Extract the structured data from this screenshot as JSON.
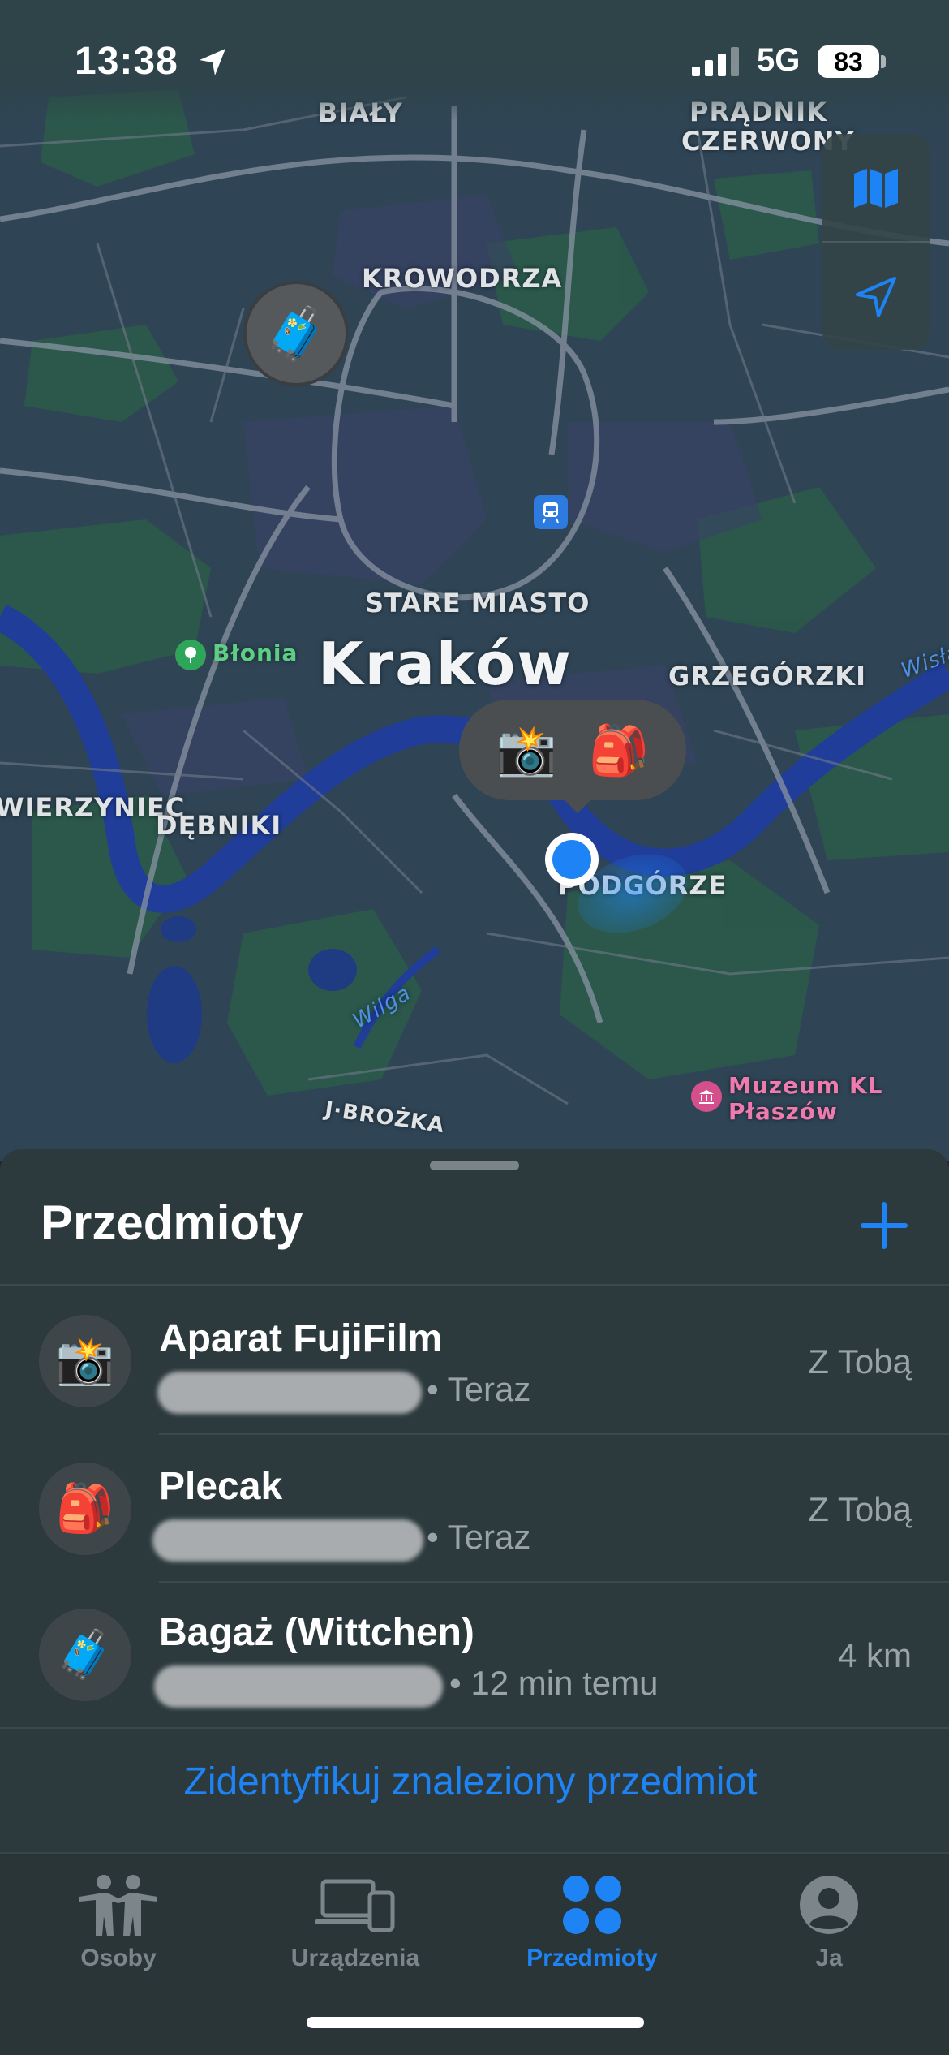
{
  "status_bar": {
    "time": "13:38",
    "network": "5G",
    "battery": "83"
  },
  "map": {
    "city": "Kraków",
    "districts": [
      "BIAŁY",
      "PRĄDNIK CZERWONY",
      "KROWODRZA",
      "STARE MIASTO",
      "GRZEGÓRZKI",
      "ZWIERZYNIEC",
      "DĘBNIKI",
      "PODGÓRZE",
      "J·BROŻKA"
    ],
    "pois": {
      "park": "Błonia",
      "museum_line1": "Muzeum KL",
      "museum_line2": "Płaszów"
    },
    "rivers": {
      "wilga": "Wilga",
      "wisla": "Wisła"
    },
    "controls": {
      "map_mode_icon": "map-icon",
      "locate_icon": "location-arrow-icon"
    }
  },
  "sheet": {
    "title": "Przedmioty",
    "items": [
      {
        "name": "Aparat FujiFilm",
        "meta": "Teraz",
        "status": "Z Tobą",
        "emoji": "📸"
      },
      {
        "name": "Plecak",
        "meta": "Teraz",
        "status": "Z Tobą",
        "emoji": "🎒"
      },
      {
        "name": "Bagaż (Wittchen)",
        "meta": "12 min temu",
        "status": "4 km",
        "emoji": "🧳"
      }
    ],
    "identify_link": "Zidentyfikuj znaleziony przedmiot"
  },
  "tabs": [
    {
      "label": "Osoby",
      "icon": "people-icon",
      "active": false
    },
    {
      "label": "Urządzenia",
      "icon": "devices-icon",
      "active": false
    },
    {
      "label": "Przedmioty",
      "icon": "items-icon",
      "active": true
    },
    {
      "label": "Ja",
      "icon": "person-icon",
      "active": false
    }
  ],
  "colors": {
    "accent": "#1e84f5",
    "sheet_bg": "#2c3a3e",
    "map_bg": "#33485a"
  }
}
